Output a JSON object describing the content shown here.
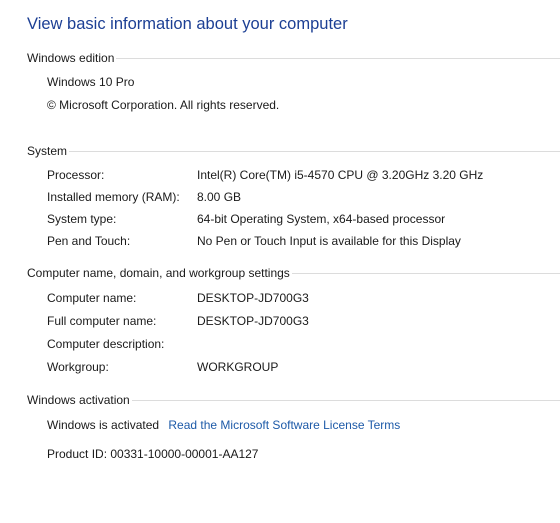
{
  "page": {
    "title": "View basic information about your computer"
  },
  "windows_edition": {
    "header": "Windows edition",
    "edition": "Windows 10 Pro",
    "copyright": "© Microsoft Corporation. All rights reserved."
  },
  "system": {
    "header": "System",
    "rows": [
      {
        "label": "Processor:",
        "value": "Intel(R) Core(TM) i5-4570 CPU @ 3.20GHz   3.20 GHz"
      },
      {
        "label": "Installed memory (RAM):",
        "value": "8.00 GB"
      },
      {
        "label": "System type:",
        "value": "64-bit Operating System, x64-based processor"
      },
      {
        "label": "Pen and Touch:",
        "value": "No Pen or Touch Input is available for this Display"
      }
    ]
  },
  "computer_name": {
    "header": "Computer name, domain, and workgroup settings",
    "rows": [
      {
        "label": "Computer name:",
        "value": "DESKTOP-JD700G3"
      },
      {
        "label": "Full computer name:",
        "value": "DESKTOP-JD700G3"
      },
      {
        "label": "Computer description:",
        "value": ""
      },
      {
        "label": "Workgroup:",
        "value": "WORKGROUP"
      }
    ]
  },
  "activation": {
    "header": "Windows activation",
    "status": "Windows is activated",
    "license_link": "Read the Microsoft Software License Terms",
    "product_id": "Product ID:  00331-10000-00001-AA127"
  }
}
